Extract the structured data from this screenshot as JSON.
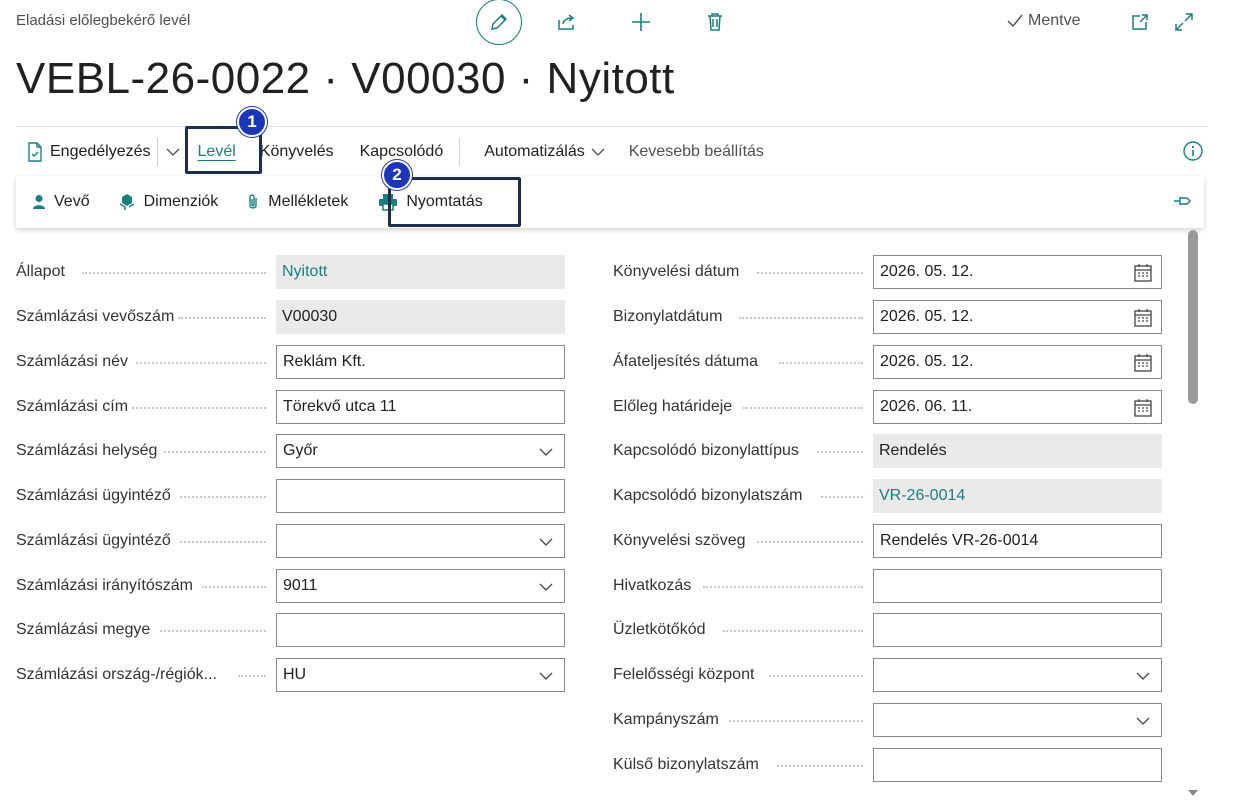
{
  "header": {
    "caption": "Eladási előlegbekérő levél",
    "title": "VEBL-26-0022 · V00030 · Nyitott",
    "saved_label": "Mentve"
  },
  "menu": {
    "items": [
      {
        "label": "Engedélyezés"
      },
      {
        "label": "Levél"
      },
      {
        "label": "Könyvelés"
      },
      {
        "label": "Kapcsolódó"
      },
      {
        "label": "Automatizálás"
      },
      {
        "label": "Kevesebb beállítás"
      }
    ]
  },
  "actions": {
    "items": [
      {
        "label": "Vevő"
      },
      {
        "label": "Dimenziók"
      },
      {
        "label": "Mellékletek"
      },
      {
        "label": "Nyomtatás"
      }
    ]
  },
  "callouts": {
    "one": "1",
    "two": "2"
  },
  "left_fields": [
    {
      "label": "Állapot",
      "value": "Nyitott"
    },
    {
      "label": "Számlázási vevőszám",
      "value": "V00030"
    },
    {
      "label": "Számlázási név",
      "value": "Reklám Kft."
    },
    {
      "label": "Számlázási cím",
      "value": "Törekvő utca 11"
    },
    {
      "label": "Számlázási helység",
      "value": "Győr"
    },
    {
      "label": "Számlázási ügyintéző",
      "value": ""
    },
    {
      "label": "Számlázási ügyintéző",
      "value": ""
    },
    {
      "label": "Számlázási irányítószám",
      "value": "9011"
    },
    {
      "label": "Számlázási megye",
      "value": ""
    },
    {
      "label": "Számlázási ország-/régiók...",
      "value": "HU"
    }
  ],
  "right_fields": [
    {
      "label": "Könyvelési dátum",
      "value": "2026. 05. 12."
    },
    {
      "label": "Bizonylatdátum",
      "value": "2026. 05. 12."
    },
    {
      "label": "Áfateljesítés dátuma",
      "value": "2026. 05. 12."
    },
    {
      "label": "Előleg határideje",
      "value": "2026. 06. 11."
    },
    {
      "label": "Kapcsolódó bizonylattípus",
      "value": "Rendelés"
    },
    {
      "label": "Kapcsolódó bizonylatszám",
      "value": "VR-26-0014"
    },
    {
      "label": "Könyvelési szöveg",
      "value": "Rendelés VR-26-0014"
    },
    {
      "label": "Hivatkozás",
      "value": ""
    },
    {
      "label": "Üzletkötőkód",
      "value": ""
    },
    {
      "label": "Felelősségi központ",
      "value": ""
    },
    {
      "label": "Kampányszám",
      "value": ""
    },
    {
      "label": "Külső bizonylatszám",
      "value": ""
    }
  ],
  "colors": {
    "accent": "#1b7f7f",
    "callout_badge": "#1b36b8",
    "callout_border": "#1f2d4d"
  }
}
